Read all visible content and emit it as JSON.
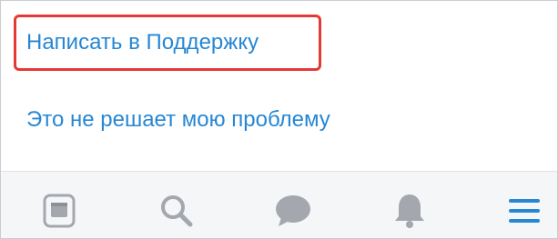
{
  "links": {
    "write_support": "Написать в Поддержку",
    "not_solved": "Это не решает мою проблему"
  },
  "tabbar": {
    "items": [
      {
        "icon": "newsfeed-icon"
      },
      {
        "icon": "search-icon"
      },
      {
        "icon": "messages-icon"
      },
      {
        "icon": "notifications-bell-icon"
      },
      {
        "icon": "menu-icon",
        "active": true
      }
    ]
  },
  "colors": {
    "link": "#2787d3",
    "highlight_border": "#e53935",
    "tab_icon_inactive": "#a4a8ae",
    "tab_icon_active": "#2787d3",
    "tabbar_bg": "#f5f6f8"
  }
}
